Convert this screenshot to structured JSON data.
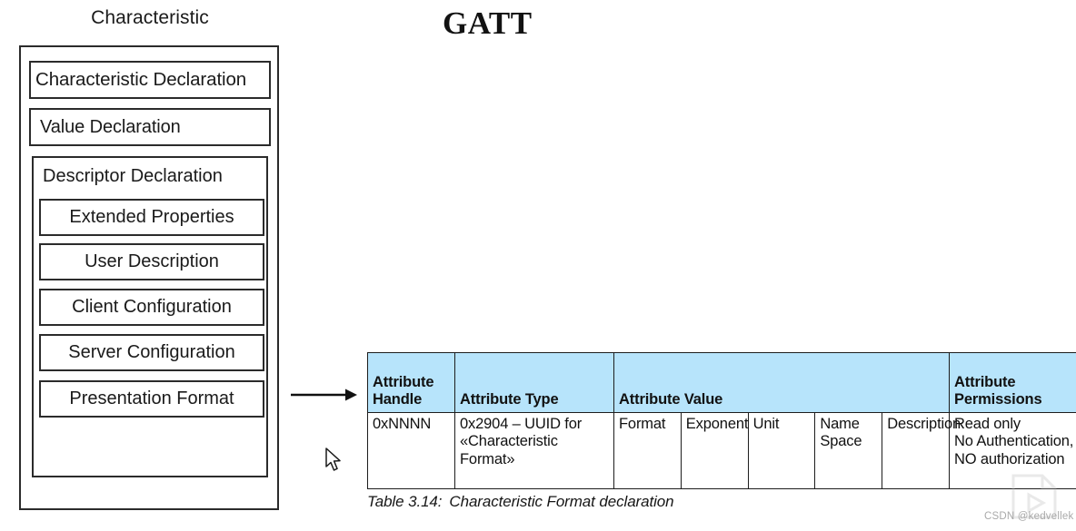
{
  "page": {
    "title": "GATT",
    "background": "#ffffff"
  },
  "diagram": {
    "title": "Characteristic",
    "boxes": {
      "characteristic_declaration": "Characteristic Declaration",
      "value_declaration": "Value Declaration",
      "descriptor_declaration": "Descriptor Declaration"
    },
    "descriptors": [
      {
        "label": "Extended Properties"
      },
      {
        "label": "User Description"
      },
      {
        "label": "Client Configuration"
      },
      {
        "label": "Server Configuration"
      },
      {
        "label": "Presentation Format"
      }
    ],
    "arrow": "flow-arrow-right"
  },
  "table": {
    "header_background": "#b7e4fb",
    "border_color": "#1d1d1d",
    "headers": [
      "Attribute Handle",
      "Attribute Type",
      "Attribute Value",
      "Attribute Permissions"
    ],
    "header_cells": {
      "attribute_handle": "Attribute\nHandle",
      "attribute_handle_l1": "Attribute",
      "attribute_handle_l2": "Handle",
      "attribute_type": "Attribute Type",
      "attribute_value": "Attribute Value",
      "attribute_permissions_l1": "Attribute",
      "attribute_permissions_l2": "Permissions"
    },
    "rows": [
      {
        "handle": "0xNNNN",
        "type": "0x2904 – UUID for «Characteristic Format»",
        "value": {
          "format": "Format",
          "exponent": "Exponent",
          "unit": "Unit",
          "name_space": "Name Space",
          "description": "Description"
        },
        "permissions": "Read only\nNo Authentication,\nNO authorization",
        "permissions_l1": "Read only",
        "permissions_l2": "No Authentication,",
        "permissions_l3": "NO authorization"
      }
    ],
    "caption_number": "Table 3.14:",
    "caption_text": "Characteristic Format declaration"
  },
  "watermark": {
    "text": "CSDN @kedvellek"
  }
}
